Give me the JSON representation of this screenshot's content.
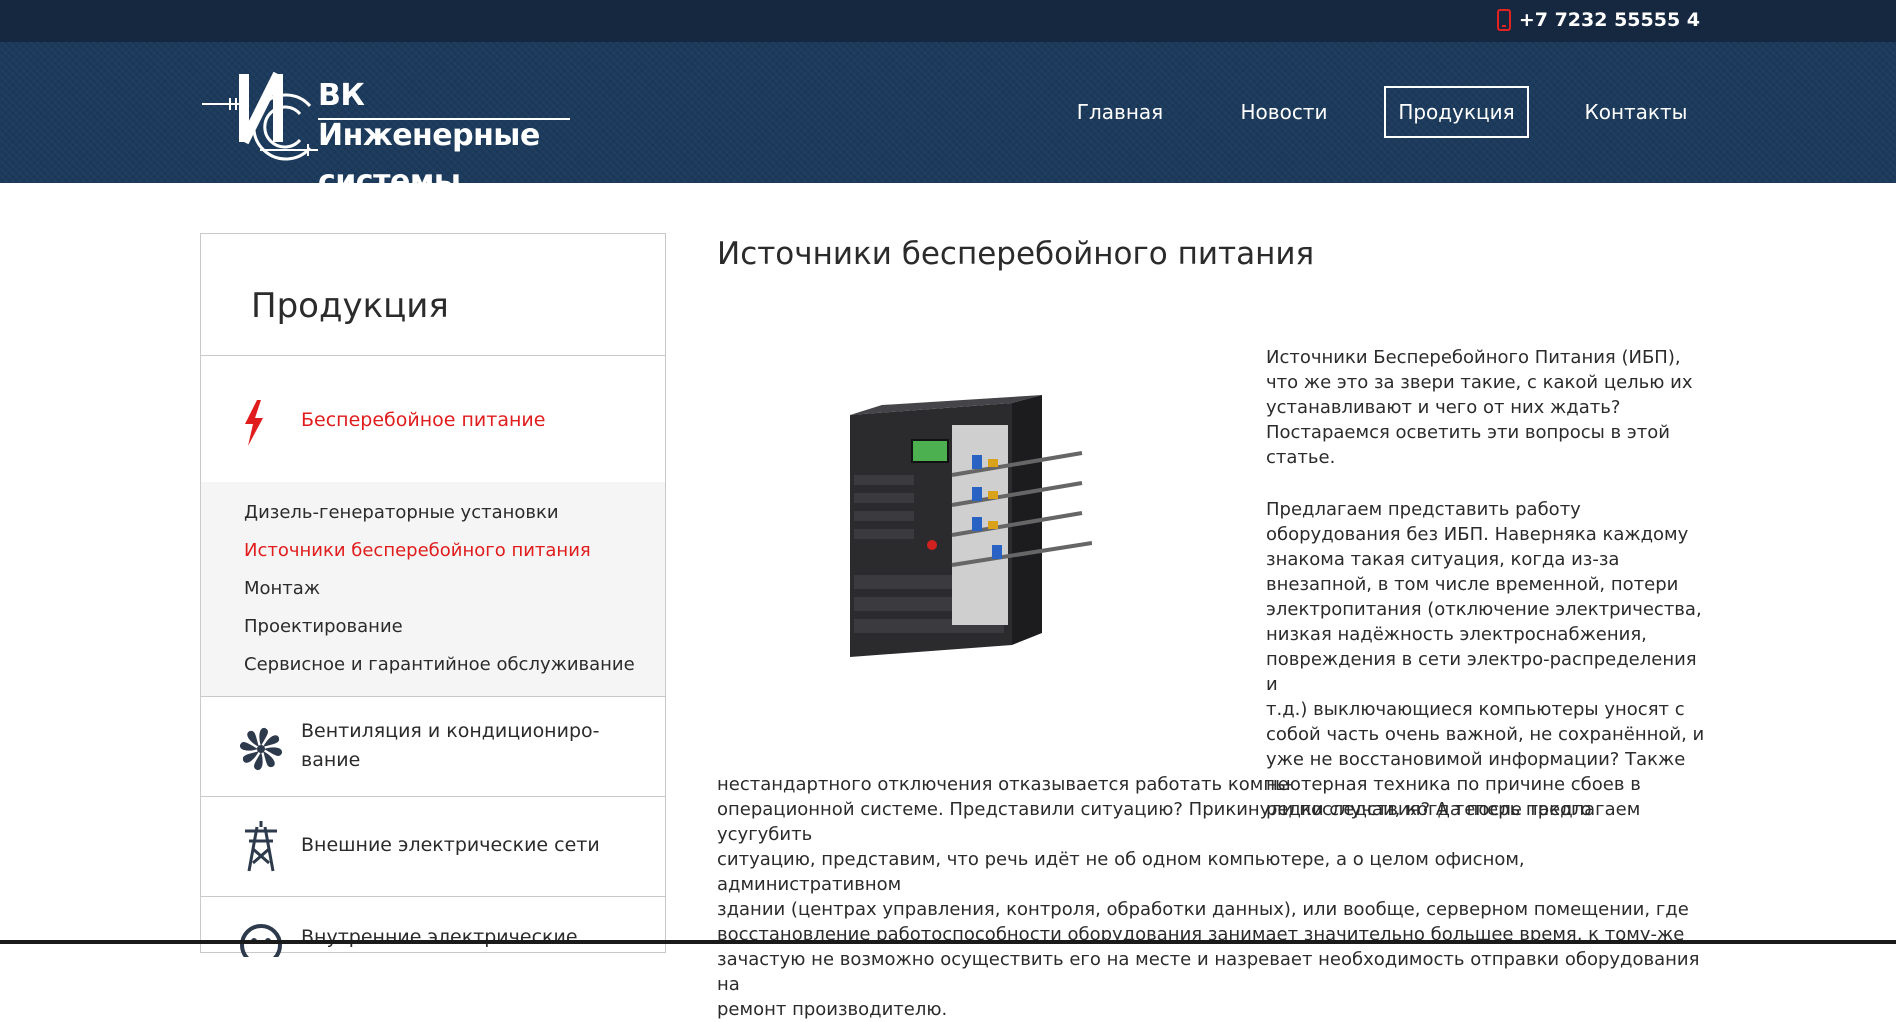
{
  "topbar": {
    "phone": "+7 7232 55555 4"
  },
  "logo": {
    "line1": "ВК Инженерные",
    "line2": "системы"
  },
  "nav": [
    {
      "label": "Главная",
      "active": false
    },
    {
      "label": "Новости",
      "active": false
    },
    {
      "label": "Продукция",
      "active": true
    },
    {
      "label": "Контакты",
      "active": false
    }
  ],
  "sidebar": {
    "title": "Продукция",
    "categories": [
      {
        "label": "Бесперебойное питание",
        "icon": "lightning-icon",
        "active": true
      },
      {
        "label_line1": "Вентиляция и кондициониро-",
        "label_line2": "вание",
        "icon": "fan-icon"
      },
      {
        "label": "Внешние электрические сети",
        "icon": "power-tower-icon"
      },
      {
        "label": "Внутренние электрические",
        "icon": "socket-icon"
      }
    ],
    "subitems": [
      {
        "label": "Дизель-генераторные установки",
        "active": false
      },
      {
        "label": "Источники бесперебойного питания",
        "active": true
      },
      {
        "label": "Монтаж",
        "active": false
      },
      {
        "label": "Проектирование",
        "active": false
      },
      {
        "label": "Сервисное и гарантийное обслуживание",
        "active": false
      }
    ]
  },
  "content": {
    "title": "Источники бесперебойного питания",
    "para1": [
      "Источники Бесперебойного Питания (ИБП),",
      "что же это за звери такие, с какой целью их",
      "устанавливают и чего от них ждать?",
      "Постараемся осветить эти вопросы в этой",
      "статье."
    ],
    "para2_narrow": [
      "Предлагаем представить работу",
      "оборудования без ИБП. Наверняка каждому",
      "знакома такая ситуация, когда из-за",
      "внезапной, в том числе временной, потери",
      "электропитания (отключение электричества,",
      "низкая надёжность электроснабжения,",
      "повреждения в сети электро-распределения и",
      "т.д.) выключающиеся компьютеры уносят с",
      "собой часть очень важной, не сохранённой, и",
      "уже не восстановимой информации? Также не",
      "редки случаи, когда после такого"
    ],
    "para2_wide": [
      "нестандартного отключения отказывается работать компьютерная техника по причине сбоев в",
      "операционной системе. Представили ситуацию? Прикинули последствия? А теперь предлагаем усугубить",
      "ситуацию, представим, что речь идёт не об одном компьютере, а о целом офисном, административном",
      "здании (центрах управления, контроля, обработки данных), или вообще, серверном помещении, где",
      "восстановление работоспособности оборудования занимает значительно большее время, к тому-же",
      "зачастую не возможно осуществить его на месте и назревает необходимость отправки оборудования на",
      "ремонт производителю."
    ]
  },
  "colors": {
    "accent": "#e01c1c",
    "topbar": "#152840",
    "header": "#1c3a5c"
  }
}
